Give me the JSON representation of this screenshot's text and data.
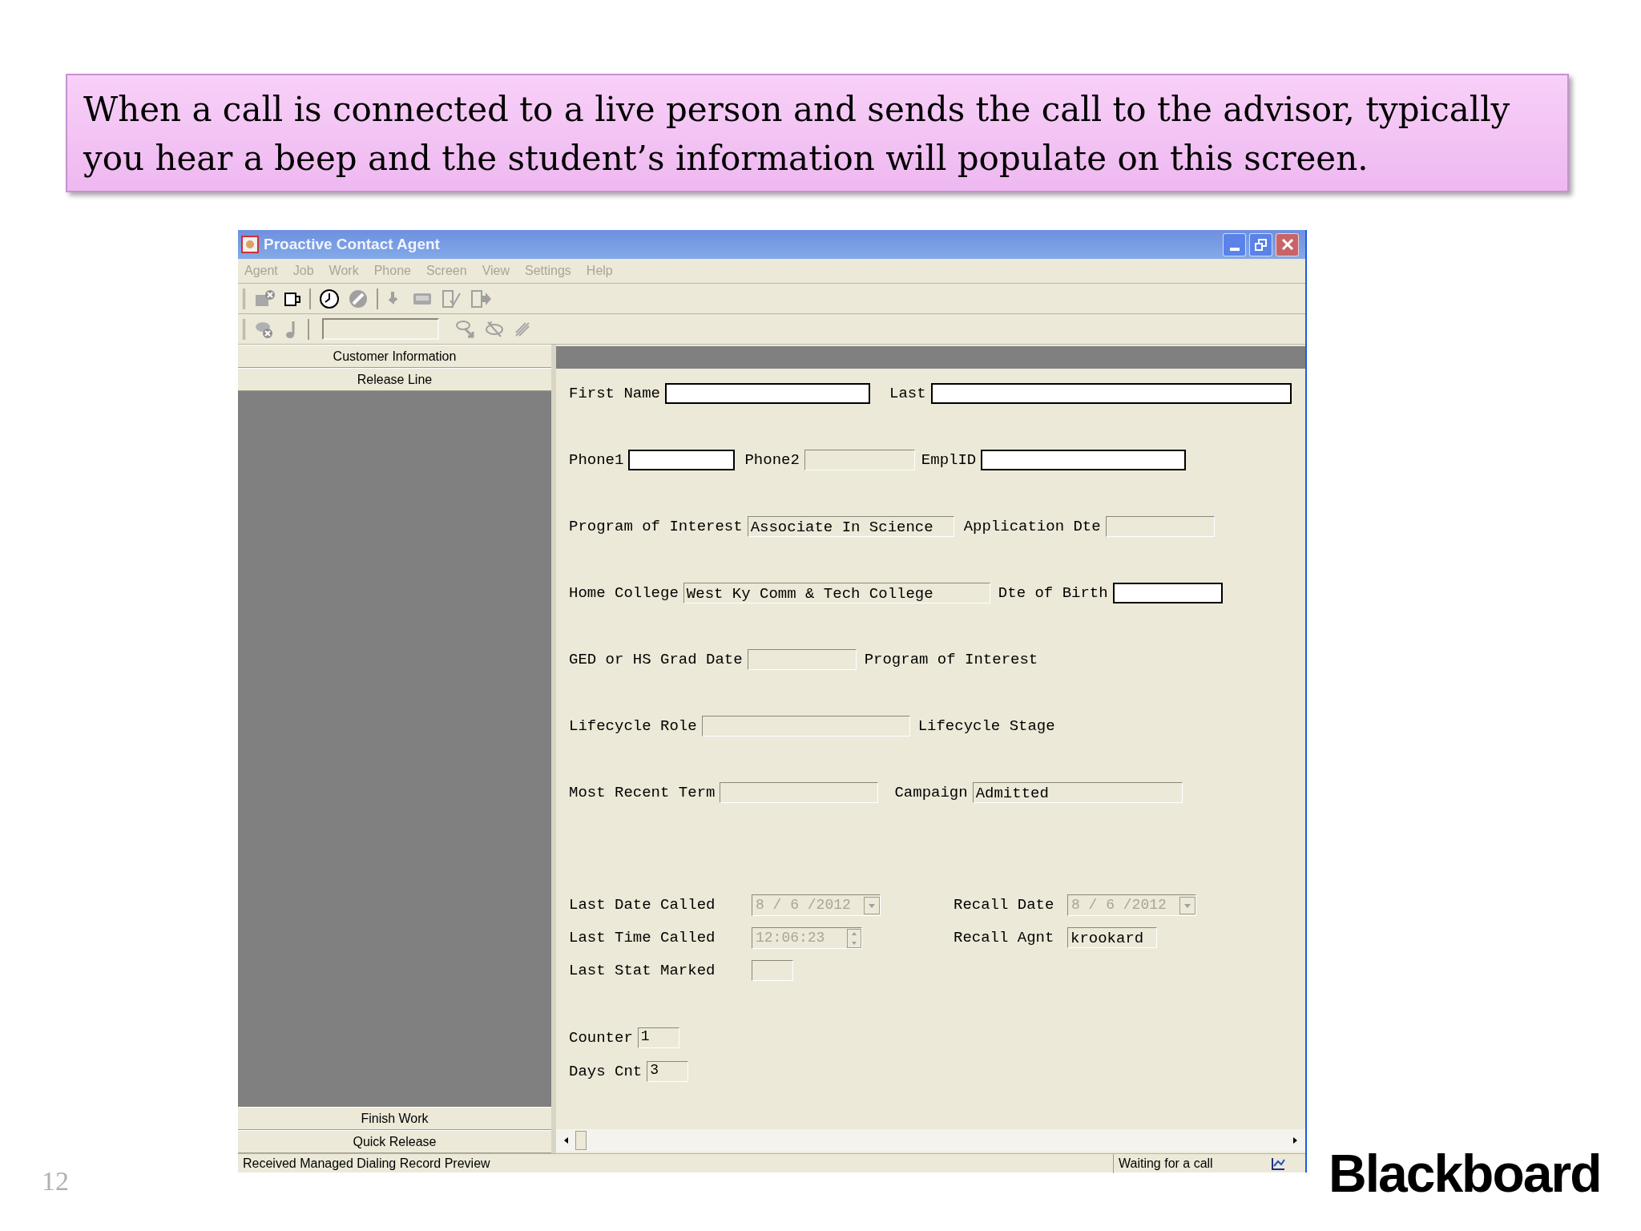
{
  "slide": {
    "callout": "When a call is connected to a live person and sends the call to the advisor, typically you hear a beep and the student’s information will populate on this screen.",
    "page_number": "12",
    "logo": "Blackboard"
  },
  "window": {
    "title": "Proactive Contact Agent"
  },
  "menu": [
    {
      "label": "Agent",
      "disabled": true
    },
    {
      "label": "Job",
      "disabled": true
    },
    {
      "label": "Work",
      "disabled": true
    },
    {
      "label": "Phone",
      "disabled": true
    },
    {
      "label": "Screen",
      "disabled": true
    },
    {
      "label": "View",
      "disabled": true
    },
    {
      "label": "Settings",
      "disabled": true
    },
    {
      "label": "Help",
      "disabled": true
    }
  ],
  "side_buttons_top": [
    "Customer Information",
    "Release Line"
  ],
  "side_buttons_bottom": [
    "Finish Work",
    "Quick Release"
  ],
  "form_rows": [
    [
      {
        "label": "First Name",
        "field": {
          "editable": true
        }
      },
      {
        "label": "Last",
        "field": {
          "editable": true
        }
      }
    ],
    [
      {
        "label": "Phone1",
        "field": {
          "editable": true
        }
      },
      {
        "label": "Phone2",
        "field": {
          "editable": false
        }
      },
      {
        "label": "EmplID",
        "field": {
          "editable": true
        }
      }
    ],
    [
      {
        "label": "Program of Interest",
        "field": {
          "editable": false,
          "value": "Associate In Science"
        }
      },
      {
        "label": "Application Dte",
        "field": {
          "editable": false
        }
      }
    ],
    [
      {
        "label": "Home College",
        "field": {
          "editable": false,
          "value": "West Ky Comm & Tech College"
        }
      },
      {
        "label": "Dte of Birth",
        "field": {
          "editable": true
        }
      }
    ],
    [
      {
        "label": "GED or HS Grad Date",
        "field": {
          "editable": false
        }
      },
      {
        "label": "Program of Interest"
      }
    ],
    [
      {
        "label": "Lifecycle Role",
        "field": {
          "editable": false
        }
      },
      {
        "label": "Lifecycle Stage"
      }
    ],
    [
      {
        "label": "Most Recent Term",
        "field": {
          "editable": false
        }
      },
      {
        "label": "Campaign",
        "field": {
          "editable": false,
          "value": "Admitted"
        }
      }
    ]
  ],
  "call_rows": [
    {
      "left": {
        "label": "Last Date Called",
        "field": {
          "kind": "date",
          "disabled": true,
          "value": "8 / 6 /2012"
        }
      },
      "right": {
        "label": "Recall Date",
        "field": {
          "kind": "date",
          "disabled": true,
          "value": "8 / 6 /2012"
        }
      }
    },
    {
      "left": {
        "label": "Last Time Called",
        "field": {
          "kind": "time",
          "disabled": true,
          "value": "12:06:23"
        }
      },
      "right": {
        "label": "Recall Agnt",
        "field": {
          "kind": "text",
          "editable": false,
          "value": "krookard"
        }
      }
    },
    {
      "left": {
        "label": "Last Stat Marked",
        "field": {
          "kind": "text",
          "editable": false
        }
      }
    }
  ],
  "counters": [
    {
      "label": "Counter",
      "value": "1"
    },
    {
      "label": "Days Cnt",
      "value": "3"
    }
  ],
  "status_bar": {
    "message": "Received Managed Dialing Record Preview",
    "state": "Waiting for a call"
  }
}
